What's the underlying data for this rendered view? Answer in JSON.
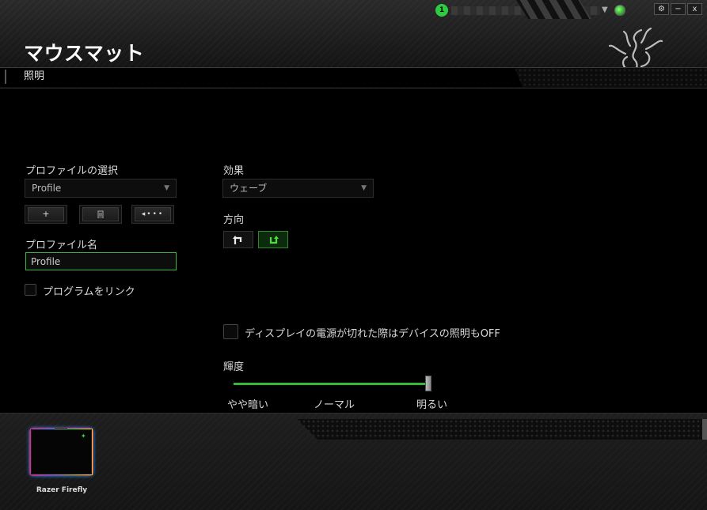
{
  "app": {
    "account_badge": "1",
    "window_controls": {
      "settings_icon": "gear-icon",
      "minimize": "−",
      "close": "x"
    }
  },
  "header": {
    "page_title": "マウスマット",
    "tab_lighting": "照明"
  },
  "profile": {
    "section_label": "プロファイルの選択",
    "selected_profile": "Profile",
    "add_button": "+",
    "delete_icon": "trash-icon",
    "more_icon": "more-icon",
    "name_label": "プロファイル名",
    "name_value": "Profile",
    "link_program_label": "プログラムをリンク"
  },
  "effect": {
    "label": "効果",
    "selected": "ウェーブ",
    "direction_label": "方向",
    "direction_left_icon": "rotate-ccw-icon",
    "direction_right_icon": "rotate-cw-icon",
    "active_direction": "right"
  },
  "display_off": {
    "label": "ディスプレイの電源が切れた際はデバイスの照明もOFF",
    "checked": false
  },
  "brightness": {
    "label": "輝度",
    "value_percent": 100,
    "tick_low": "やや暗い",
    "tick_mid": "ノーマル",
    "tick_high": "明るい"
  },
  "footer": {
    "device_name": "Razer Firefly"
  },
  "colors": {
    "accent_green": "#44d62c",
    "background": "#000000"
  }
}
